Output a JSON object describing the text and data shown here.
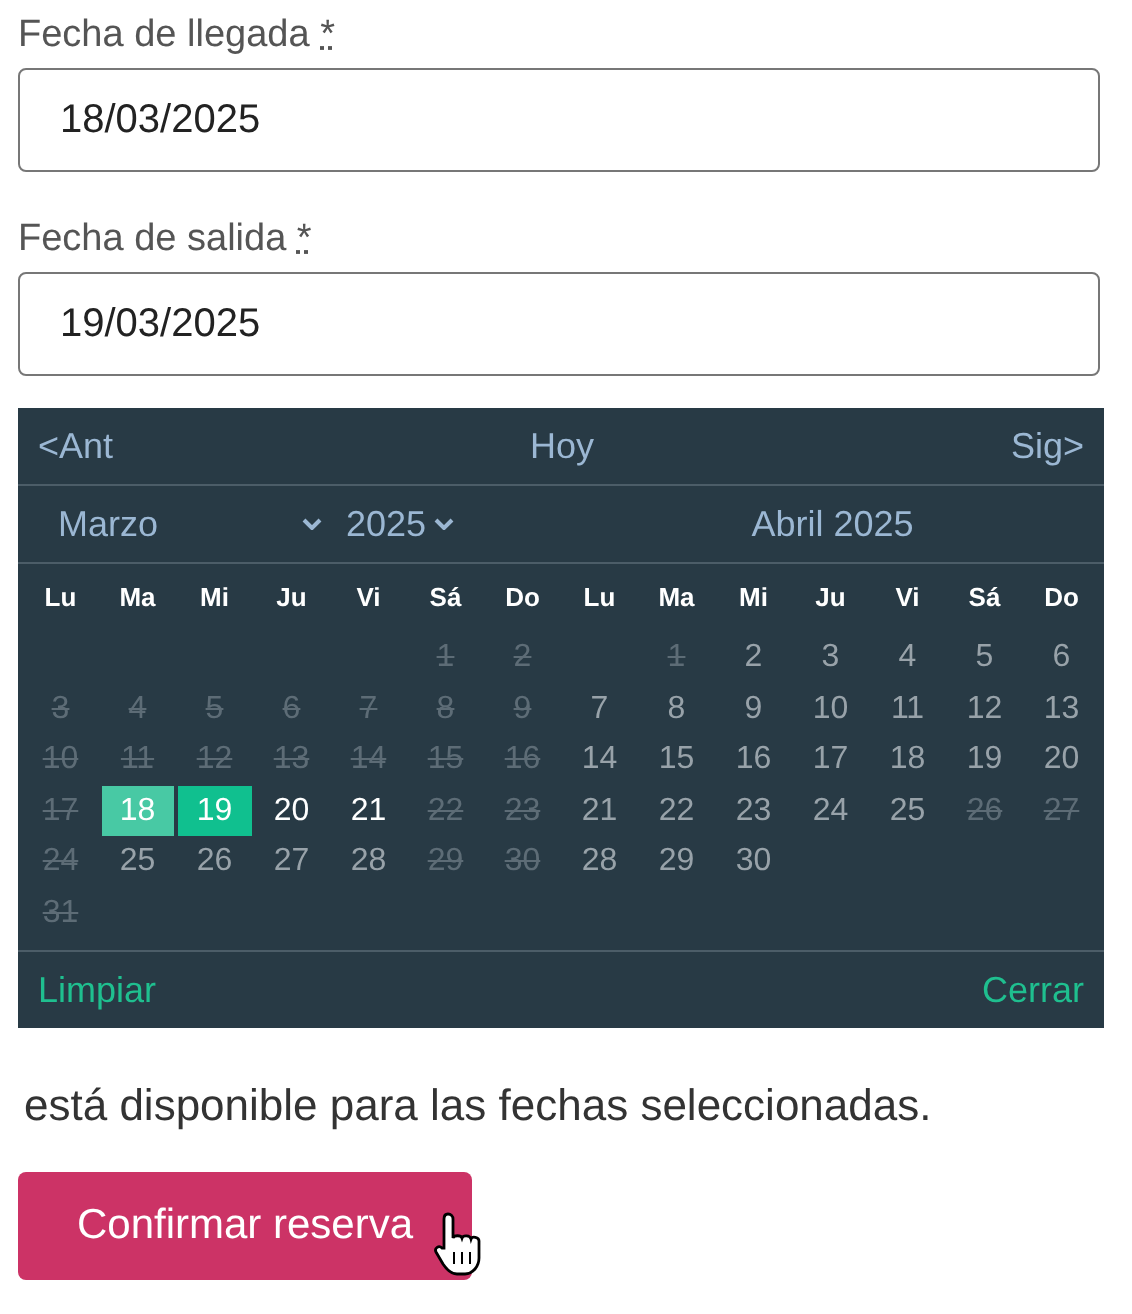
{
  "fields": [
    {
      "label": "Fecha de llegada",
      "required_mark": "*",
      "value": "18/03/2025"
    },
    {
      "label": "Fecha de salida",
      "required_mark": "*",
      "value": "19/03/2025"
    }
  ],
  "calendar": {
    "prev": "<Ant",
    "today": "Hoy",
    "next": "Sig>",
    "months": [
      {
        "kind": "selects",
        "month": "Marzo",
        "year": "2025",
        "weekdays": [
          "Lu",
          "Ma",
          "Mi",
          "Ju",
          "Vi",
          "Sá",
          "Do"
        ],
        "weeks": [
          [
            {
              "kind": "blank"
            },
            {
              "kind": "blank"
            },
            {
              "kind": "blank"
            },
            {
              "kind": "blank"
            },
            {
              "kind": "blank"
            },
            {
              "text": "1",
              "kind": "blocked"
            },
            {
              "text": "2",
              "kind": "blocked"
            }
          ],
          [
            {
              "text": "3",
              "kind": "blocked"
            },
            {
              "text": "4",
              "kind": "blocked"
            },
            {
              "text": "5",
              "kind": "blocked"
            },
            {
              "text": "6",
              "kind": "blocked"
            },
            {
              "text": "7",
              "kind": "blocked"
            },
            {
              "text": "8",
              "kind": "blocked"
            },
            {
              "text": "9",
              "kind": "blocked"
            }
          ],
          [
            {
              "text": "10",
              "kind": "blocked"
            },
            {
              "text": "11",
              "kind": "blocked"
            },
            {
              "text": "12",
              "kind": "blocked"
            },
            {
              "text": "13",
              "kind": "blocked"
            },
            {
              "text": "14",
              "kind": "blocked"
            },
            {
              "text": "15",
              "kind": "blocked"
            },
            {
              "text": "16",
              "kind": "blocked"
            }
          ],
          [
            {
              "text": "17",
              "kind": "blocked"
            },
            {
              "text": "18",
              "kind": "checkin"
            },
            {
              "text": "19",
              "kind": "checkout"
            },
            {
              "text": "20",
              "kind": "bright"
            },
            {
              "text": "21",
              "kind": "bright"
            },
            {
              "text": "22",
              "kind": "blocked"
            },
            {
              "text": "23",
              "kind": "blocked"
            }
          ],
          [
            {
              "text": "24",
              "kind": "blocked"
            },
            {
              "text": "25",
              "kind": "open"
            },
            {
              "text": "26",
              "kind": "open"
            },
            {
              "text": "27",
              "kind": "open"
            },
            {
              "text": "28",
              "kind": "open"
            },
            {
              "text": "29",
              "kind": "blocked"
            },
            {
              "text": "30",
              "kind": "blocked"
            }
          ],
          [
            {
              "text": "31",
              "kind": "blocked"
            }
          ]
        ]
      },
      {
        "kind": "title",
        "title": "Abril 2025",
        "weekdays": [
          "Lu",
          "Ma",
          "Mi",
          "Ju",
          "Vi",
          "Sá",
          "Do"
        ],
        "weeks": [
          [
            {
              "kind": "blank"
            },
            {
              "text": "1",
              "kind": "blocked"
            },
            {
              "text": "2",
              "kind": "open"
            },
            {
              "text": "3",
              "kind": "open"
            },
            {
              "text": "4",
              "kind": "open"
            },
            {
              "text": "5",
              "kind": "open"
            },
            {
              "text": "6",
              "kind": "open"
            }
          ],
          [
            {
              "text": "7",
              "kind": "open"
            },
            {
              "text": "8",
              "kind": "open"
            },
            {
              "text": "9",
              "kind": "open"
            },
            {
              "text": "10",
              "kind": "open"
            },
            {
              "text": "11",
              "kind": "open"
            },
            {
              "text": "12",
              "kind": "open"
            },
            {
              "text": "13",
              "kind": "open"
            }
          ],
          [
            {
              "text": "14",
              "kind": "open"
            },
            {
              "text": "15",
              "kind": "open"
            },
            {
              "text": "16",
              "kind": "open"
            },
            {
              "text": "17",
              "kind": "open"
            },
            {
              "text": "18",
              "kind": "open"
            },
            {
              "text": "19",
              "kind": "open"
            },
            {
              "text": "20",
              "kind": "open"
            }
          ],
          [
            {
              "text": "21",
              "kind": "open"
            },
            {
              "text": "22",
              "kind": "open"
            },
            {
              "text": "23",
              "kind": "open"
            },
            {
              "text": "24",
              "kind": "open"
            },
            {
              "text": "25",
              "kind": "open"
            },
            {
              "text": "26",
              "kind": "blocked"
            },
            {
              "text": "27",
              "kind": "blocked"
            }
          ],
          [
            {
              "text": "28",
              "kind": "open"
            },
            {
              "text": "29",
              "kind": "open"
            },
            {
              "text": "30",
              "kind": "open"
            }
          ]
        ]
      }
    ],
    "clear": "Limpiar",
    "close": "Cerrar"
  },
  "availability_text": "está disponible para las fechas seleccionadas.",
  "confirm_button": "Confirmar reserva"
}
